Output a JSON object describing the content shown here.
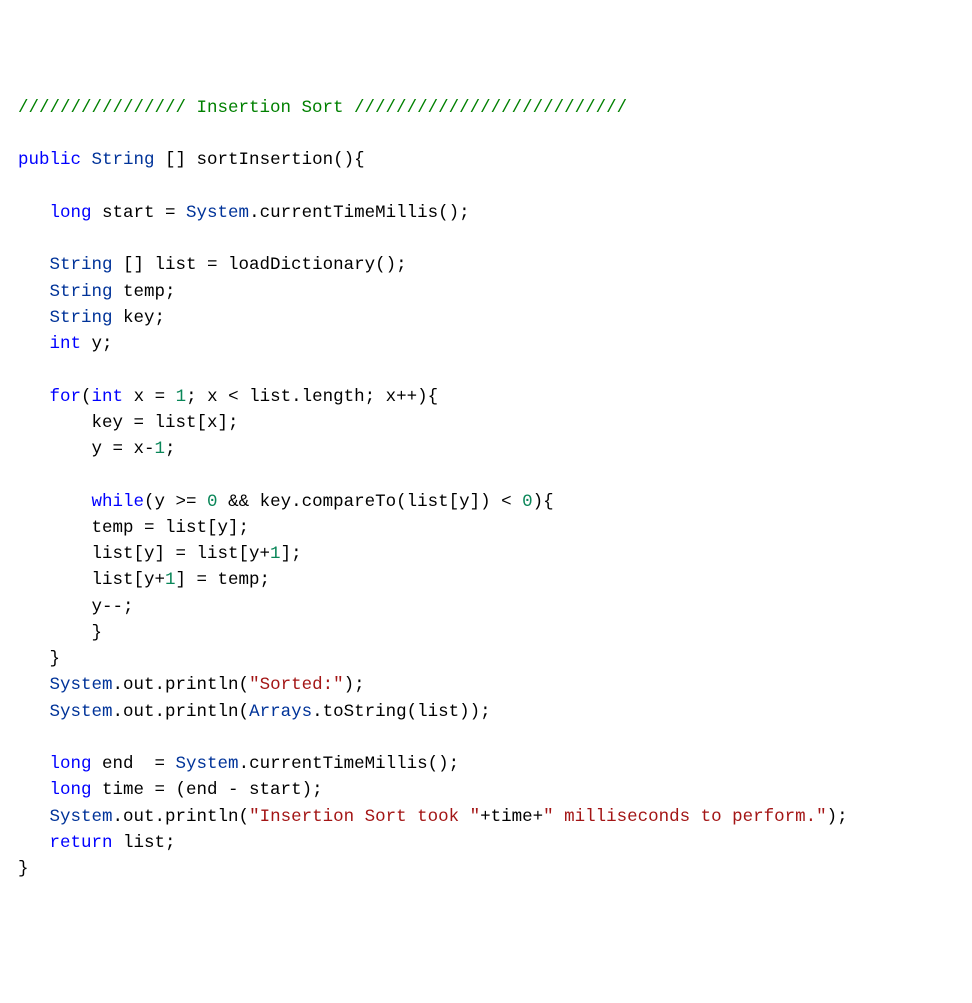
{
  "tokens": [
    [
      [
        "cm",
        "//////////////// Insertion Sort //////////////////////////"
      ]
    ],
    [],
    [
      [
        "kw",
        "public"
      ],
      [
        "pl",
        " "
      ],
      [
        "ty",
        "String"
      ],
      [
        "pl",
        " [] sortInsertion(){"
      ]
    ],
    [],
    [
      [
        "pl",
        "   "
      ],
      [
        "kw",
        "long"
      ],
      [
        "pl",
        " start = "
      ],
      [
        "ty",
        "System"
      ],
      [
        "pl",
        ".currentTimeMillis();"
      ]
    ],
    [],
    [
      [
        "pl",
        "   "
      ],
      [
        "ty",
        "String"
      ],
      [
        "pl",
        " [] list = loadDictionary();"
      ]
    ],
    [
      [
        "pl",
        "   "
      ],
      [
        "ty",
        "String"
      ],
      [
        "pl",
        " temp;"
      ]
    ],
    [
      [
        "pl",
        "   "
      ],
      [
        "ty",
        "String"
      ],
      [
        "pl",
        " key;"
      ]
    ],
    [
      [
        "pl",
        "   "
      ],
      [
        "kw",
        "int"
      ],
      [
        "pl",
        " y;"
      ]
    ],
    [],
    [
      [
        "pl",
        "   "
      ],
      [
        "kw",
        "for"
      ],
      [
        "pl",
        "("
      ],
      [
        "kw",
        "int"
      ],
      [
        "pl",
        " x = "
      ],
      [
        "num",
        "1"
      ],
      [
        "pl",
        "; x < list.length; x++){"
      ]
    ],
    [
      [
        "pl",
        "       key = list[x];"
      ]
    ],
    [
      [
        "pl",
        "       y = x-"
      ],
      [
        "num",
        "1"
      ],
      [
        "pl",
        ";"
      ]
    ],
    [],
    [
      [
        "pl",
        "       "
      ],
      [
        "kw",
        "while"
      ],
      [
        "pl",
        "(y >= "
      ],
      [
        "num",
        "0"
      ],
      [
        "pl",
        " && key.compareTo(list[y]) < "
      ],
      [
        "num",
        "0"
      ],
      [
        "pl",
        "){"
      ]
    ],
    [
      [
        "pl",
        "       temp = list[y];"
      ]
    ],
    [
      [
        "pl",
        "       list[y] = list[y+"
      ],
      [
        "num",
        "1"
      ],
      [
        "pl",
        "];"
      ]
    ],
    [
      [
        "pl",
        "       list[y+"
      ],
      [
        "num",
        "1"
      ],
      [
        "pl",
        "] = temp;"
      ]
    ],
    [
      [
        "pl",
        "       y--;"
      ]
    ],
    [
      [
        "pl",
        "       }"
      ]
    ],
    [
      [
        "pl",
        "   }"
      ]
    ],
    [
      [
        "pl",
        "   "
      ],
      [
        "ty",
        "System"
      ],
      [
        "pl",
        ".out.println("
      ],
      [
        "str",
        "\"Sorted:\""
      ],
      [
        "pl",
        ");"
      ]
    ],
    [
      [
        "pl",
        "   "
      ],
      [
        "ty",
        "System"
      ],
      [
        "pl",
        ".out.println("
      ],
      [
        "ty",
        "Arrays"
      ],
      [
        "pl",
        ".toString(list));"
      ]
    ],
    [],
    [
      [
        "pl",
        "   "
      ],
      [
        "kw",
        "long"
      ],
      [
        "pl",
        " end  = "
      ],
      [
        "ty",
        "System"
      ],
      [
        "pl",
        ".currentTimeMillis();"
      ]
    ],
    [
      [
        "pl",
        "   "
      ],
      [
        "kw",
        "long"
      ],
      [
        "pl",
        " time = (end - start);"
      ]
    ],
    [
      [
        "pl",
        "   "
      ],
      [
        "ty",
        "System"
      ],
      [
        "pl",
        ".out.println("
      ],
      [
        "str",
        "\"Insertion Sort took \""
      ],
      [
        "pl",
        "+time+"
      ],
      [
        "str",
        "\" milliseconds to perform.\""
      ],
      [
        "pl",
        ");"
      ]
    ],
    [
      [
        "pl",
        "   "
      ],
      [
        "kw",
        "return"
      ],
      [
        "pl",
        " list;"
      ]
    ],
    [
      [
        "pl",
        "}"
      ]
    ]
  ]
}
